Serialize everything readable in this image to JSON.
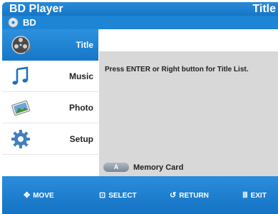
{
  "header": {
    "app_title": "BD Player",
    "section_title": "Title"
  },
  "source": {
    "icon": "disc-icon",
    "label": "BD"
  },
  "menu": {
    "items": [
      {
        "label": "Title",
        "icon": "film-reel-icon",
        "active": true
      },
      {
        "label": "Music",
        "icon": "music-note-icon",
        "active": false
      },
      {
        "label": "Photo",
        "icon": "photo-icon",
        "active": false
      },
      {
        "label": "Setup",
        "icon": "gear-icon",
        "active": false
      }
    ]
  },
  "content": {
    "message": "Press ENTER or Right button for Title List."
  },
  "memory_card": {
    "key": "A",
    "label": "Memory Card"
  },
  "footer": {
    "move": {
      "icon": "move-arrows-icon",
      "label": "MOVE"
    },
    "select": {
      "icon": "select-icon",
      "label": "SELECT"
    },
    "return": {
      "icon": "return-icon",
      "label": "RETURN"
    },
    "exit": {
      "icon": "exit-icon",
      "label": "EXIT"
    }
  },
  "colors": {
    "accent": "#1e85d4",
    "panel": "#d8d8d8"
  }
}
